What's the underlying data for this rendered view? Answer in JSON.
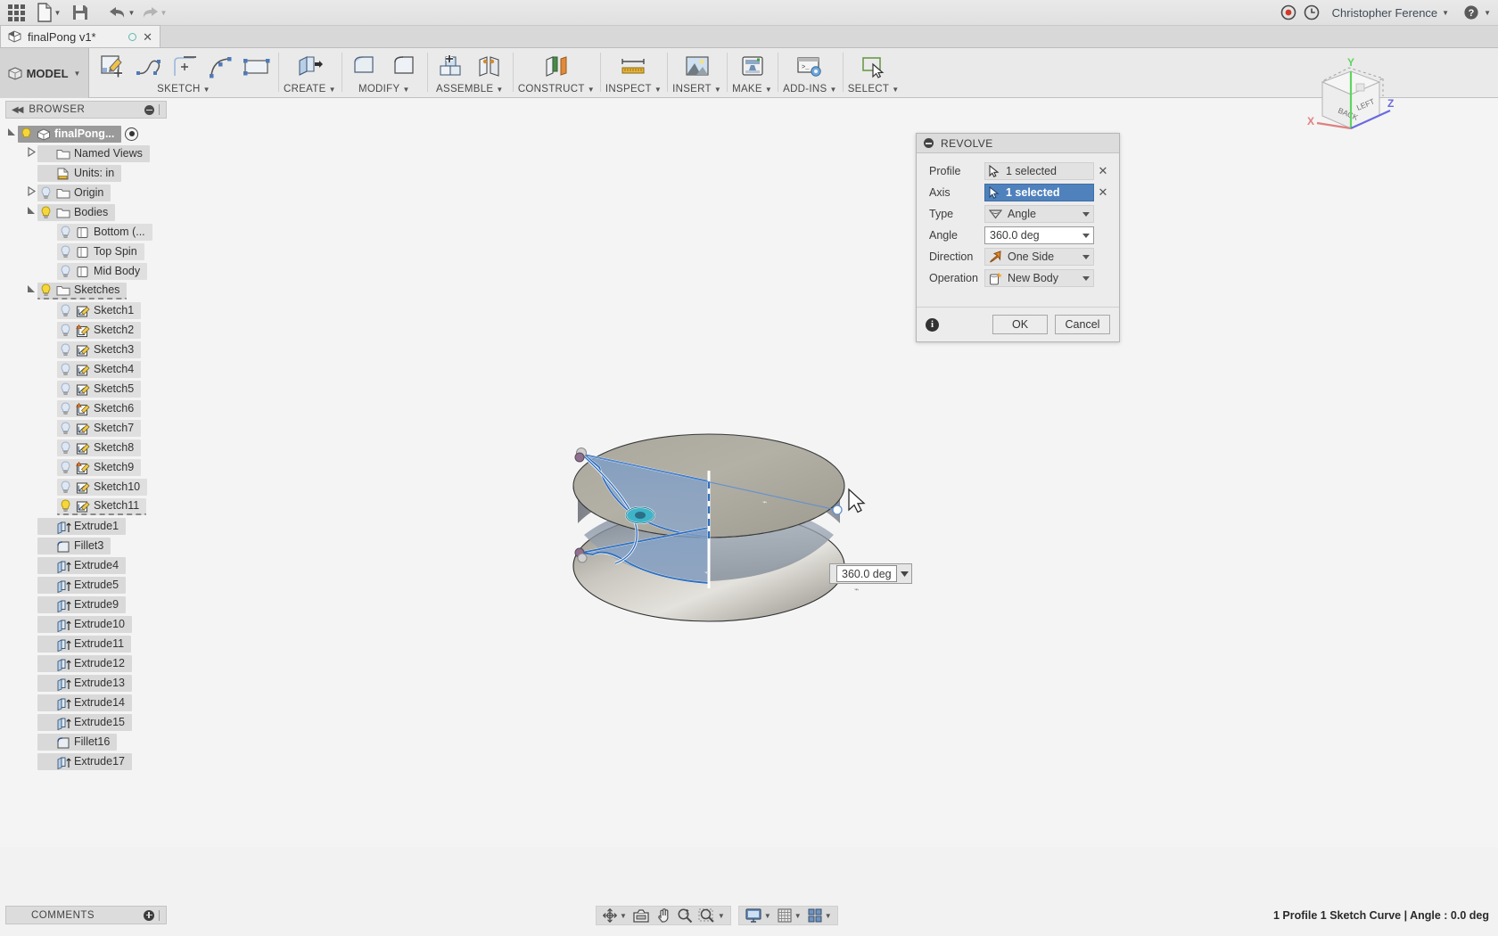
{
  "quickbar": {
    "apps_icon": "grid-apps-icon",
    "new_icon": "new-document-icon",
    "save_icon": "save-icon",
    "undo_icon": "undo-icon",
    "redo_icon": "redo-icon",
    "record_icon": "record-icon",
    "history_icon": "clock-history-icon",
    "user_name": "Christopher Ference",
    "help_icon": "help-icon"
  },
  "tab": {
    "title": "finalPong v1*",
    "cube_icon": "document-cube-icon",
    "sync_icon": "sync-circle-icon",
    "close_icon": "close-icon"
  },
  "ribbon": {
    "mode_label": "MODEL",
    "groups": [
      {
        "label": "SKETCH",
        "icons": [
          "create-sketch-icon",
          "spline-icon",
          "line-icon",
          "arc-icon",
          "rectangle-icon"
        ]
      },
      {
        "label": "CREATE",
        "icons": [
          "extrude-icon"
        ]
      },
      {
        "label": "MODIFY",
        "icons": [
          "press-pull-icon",
          "fillet-icon"
        ]
      },
      {
        "label": "ASSEMBLE",
        "icons": [
          "new-component-icon",
          "joint-icon"
        ]
      },
      {
        "label": "CONSTRUCT",
        "icons": [
          "offset-plane-icon"
        ]
      },
      {
        "label": "INSPECT",
        "icons": [
          "measure-icon"
        ]
      },
      {
        "label": "INSERT",
        "icons": [
          "insert-image-icon"
        ]
      },
      {
        "label": "MAKE",
        "icons": [
          "3d-print-icon"
        ]
      },
      {
        "label": "ADD-INS",
        "icons": [
          "script-addin-icon"
        ]
      },
      {
        "label": "SELECT",
        "icons": [
          "select-window-icon"
        ]
      }
    ]
  },
  "browser": {
    "header": "BROWSER",
    "collapse_icon": "collapse-left-icon",
    "minimize_icon": "minimize-icon",
    "tree": [
      {
        "label": "finalPong...",
        "indent": 0,
        "arrow": "open",
        "bulb": "on",
        "icon": "component-icon",
        "selected": true,
        "eye": true
      },
      {
        "label": "Named Views",
        "indent": 1,
        "arrow": "closed",
        "bulb": "none",
        "icon": "folder-icon"
      },
      {
        "label": "Units: in",
        "indent": 1,
        "arrow": "none",
        "bulb": "none",
        "icon": "units-icon"
      },
      {
        "label": "Origin",
        "indent": 1,
        "arrow": "closed",
        "bulb": "off",
        "icon": "folder-icon"
      },
      {
        "label": "Bodies",
        "indent": 1,
        "arrow": "open",
        "bulb": "on",
        "icon": "folder-icon"
      },
      {
        "label": "Bottom (...",
        "indent": 2,
        "arrow": "none",
        "bulb": "off",
        "icon": "body-icon"
      },
      {
        "label": "Top Spin",
        "indent": 2,
        "arrow": "none",
        "bulb": "off",
        "icon": "body-icon"
      },
      {
        "label": "Mid Body",
        "indent": 2,
        "arrow": "none",
        "bulb": "off",
        "icon": "body-icon"
      },
      {
        "label": "Sketches",
        "indent": 1,
        "arrow": "open",
        "bulb": "on",
        "icon": "folder-icon",
        "dashed": true
      },
      {
        "label": "Sketch1",
        "indent": 2,
        "arrow": "none",
        "bulb": "off",
        "icon": "sketch-icon"
      },
      {
        "label": "Sketch2",
        "indent": 2,
        "arrow": "none",
        "bulb": "off",
        "icon": "sketch-warning-icon"
      },
      {
        "label": "Sketch3",
        "indent": 2,
        "arrow": "none",
        "bulb": "off",
        "icon": "sketch-icon"
      },
      {
        "label": "Sketch4",
        "indent": 2,
        "arrow": "none",
        "bulb": "off",
        "icon": "sketch-icon"
      },
      {
        "label": "Sketch5",
        "indent": 2,
        "arrow": "none",
        "bulb": "off",
        "icon": "sketch-icon"
      },
      {
        "label": "Sketch6",
        "indent": 2,
        "arrow": "none",
        "bulb": "off",
        "icon": "sketch-warning-icon"
      },
      {
        "label": "Sketch7",
        "indent": 2,
        "arrow": "none",
        "bulb": "off",
        "icon": "sketch-icon"
      },
      {
        "label": "Sketch8",
        "indent": 2,
        "arrow": "none",
        "bulb": "off",
        "icon": "sketch-icon"
      },
      {
        "label": "Sketch9",
        "indent": 2,
        "arrow": "none",
        "bulb": "off",
        "icon": "sketch-warning-icon"
      },
      {
        "label": "Sketch10",
        "indent": 2,
        "arrow": "none",
        "bulb": "off",
        "icon": "sketch-icon"
      },
      {
        "label": "Sketch11",
        "indent": 2,
        "arrow": "none",
        "bulb": "on",
        "icon": "sketch-icon",
        "dashed": true
      },
      {
        "label": "Extrude1",
        "indent": 1,
        "arrow": "none",
        "bulb": "none",
        "icon": "extrude-feature-icon"
      },
      {
        "label": "Fillet3",
        "indent": 1,
        "arrow": "none",
        "bulb": "none",
        "icon": "fillet-feature-icon"
      },
      {
        "label": "Extrude4",
        "indent": 1,
        "arrow": "none",
        "bulb": "none",
        "icon": "extrude-feature-icon"
      },
      {
        "label": "Extrude5",
        "indent": 1,
        "arrow": "none",
        "bulb": "none",
        "icon": "extrude-feature-icon"
      },
      {
        "label": "Extrude9",
        "indent": 1,
        "arrow": "none",
        "bulb": "none",
        "icon": "extrude-feature-icon"
      },
      {
        "label": "Extrude10",
        "indent": 1,
        "arrow": "none",
        "bulb": "none",
        "icon": "extrude-feature-icon"
      },
      {
        "label": "Extrude11",
        "indent": 1,
        "arrow": "none",
        "bulb": "none",
        "icon": "extrude-feature-icon"
      },
      {
        "label": "Extrude12",
        "indent": 1,
        "arrow": "none",
        "bulb": "none",
        "icon": "extrude-feature-icon"
      },
      {
        "label": "Extrude13",
        "indent": 1,
        "arrow": "none",
        "bulb": "none",
        "icon": "extrude-feature-icon"
      },
      {
        "label": "Extrude14",
        "indent": 1,
        "arrow": "none",
        "bulb": "none",
        "icon": "extrude-feature-icon"
      },
      {
        "label": "Extrude15",
        "indent": 1,
        "arrow": "none",
        "bulb": "none",
        "icon": "extrude-feature-icon"
      },
      {
        "label": "Fillet16",
        "indent": 1,
        "arrow": "none",
        "bulb": "none",
        "icon": "fillet-feature-icon"
      },
      {
        "label": "Extrude17",
        "indent": 1,
        "arrow": "none",
        "bulb": "none",
        "icon": "extrude-feature-icon"
      }
    ]
  },
  "dialog": {
    "title": "REVOLVE",
    "rows": [
      {
        "label": "Profile",
        "value": "1 selected",
        "icon": "cursor-select-icon",
        "kind": "select",
        "clear": "✕"
      },
      {
        "label": "Axis",
        "value": "1 selected",
        "icon": "cursor-select-icon",
        "kind": "select-active",
        "clear": "✕"
      },
      {
        "label": "Type",
        "value": "Angle",
        "icon": "angle-type-icon",
        "kind": "dropdown"
      },
      {
        "label": "Angle",
        "value": "360.0 deg",
        "icon": "",
        "kind": "input"
      },
      {
        "label": "Direction",
        "value": "One Side",
        "icon": "one-side-icon",
        "kind": "dropdown"
      },
      {
        "label": "Operation",
        "value": "New Body",
        "icon": "new-body-icon",
        "kind": "dropdown"
      }
    ],
    "info_icon": "info-icon",
    "ok_label": "OK",
    "cancel_label": "Cancel"
  },
  "canvas_field": {
    "value": "360.0 deg",
    "dropdown_icon": "chevron-down-icon"
  },
  "viewcube": {
    "face_back": "BACK",
    "face_left": "LEFT",
    "axis_x": "X",
    "axis_y": "Y",
    "axis_z": "Z",
    "color_x": "#e08080",
    "color_y": "#5fd45f",
    "color_z": "#6a6ae0"
  },
  "comments": {
    "label": "COMMENTS",
    "add_icon": "add-comment-icon"
  },
  "navbar": {
    "groups": [
      {
        "buttons": [
          {
            "icon": "orbit-icon",
            "caret": true
          },
          {
            "icon": "look-at-icon",
            "caret": false
          },
          {
            "icon": "pan-icon",
            "caret": false
          },
          {
            "icon": "zoom-icon",
            "caret": false
          },
          {
            "icon": "zoom-window-icon",
            "caret": true
          }
        ]
      },
      {
        "buttons": [
          {
            "icon": "display-settings-icon",
            "caret": true
          },
          {
            "icon": "grid-snap-icon",
            "caret": true
          },
          {
            "icon": "viewports-icon",
            "caret": true
          }
        ]
      }
    ]
  },
  "statusbar": {
    "text": "1 Profile 1 Sketch Curve | Angle : 0.0 deg"
  },
  "colors": {
    "accent_blue": "#4f81bd",
    "panel_bg": "#ececec",
    "canvas_bg": "#f4f4f4",
    "ribbon_bg": "#eaeaea"
  }
}
